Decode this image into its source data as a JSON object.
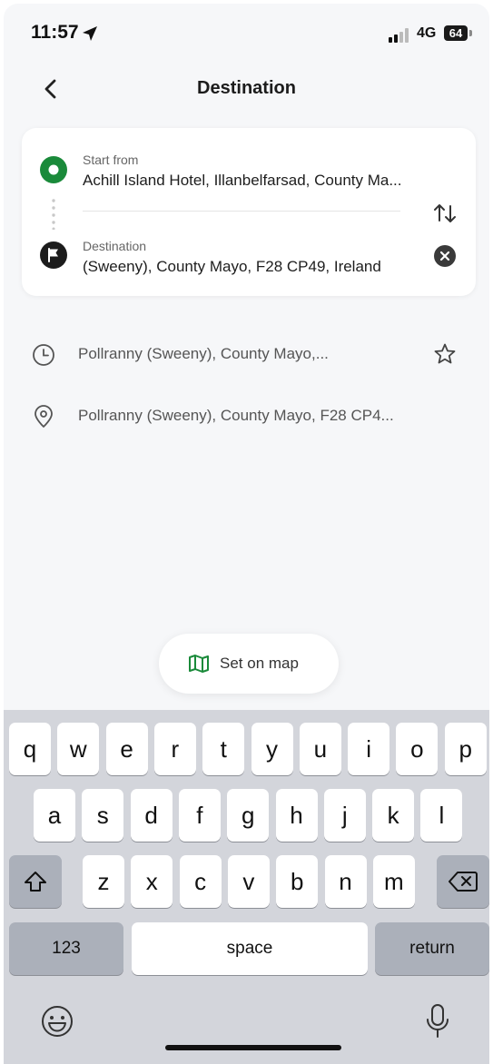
{
  "status_bar": {
    "time": "11:57",
    "network": "4G",
    "battery": "64"
  },
  "header": {
    "title": "Destination"
  },
  "route": {
    "start_label": "Start from",
    "start_value": "Achill Island Hotel, Illanbelfarsad, County Ma...",
    "destination_label": "Destination",
    "destination_value": "(Sweeny), County Mayo, F28 CP49, Ireland"
  },
  "suggestions": [
    {
      "icon": "clock-icon",
      "text": "Pollranny (Sweeny), County Mayo,..."
    },
    {
      "icon": "map-pin-icon",
      "text": "Pollranny (Sweeny), County Mayo, F28 CP4..."
    }
  ],
  "set_on_map": {
    "label": "Set on map"
  },
  "keyboard": {
    "row1": [
      "q",
      "w",
      "e",
      "r",
      "t",
      "y",
      "u",
      "i",
      "o",
      "p"
    ],
    "row2": [
      "a",
      "s",
      "d",
      "f",
      "g",
      "h",
      "j",
      "k",
      "l"
    ],
    "row3": [
      "z",
      "x",
      "c",
      "v",
      "b",
      "n",
      "m"
    ],
    "numbers_label": "123",
    "space_label": "space",
    "return_label": "return"
  },
  "colors": {
    "accent_green": "#1a8a3a",
    "background": "#f6f7f9",
    "keyboard_bg": "#d3d5db",
    "dark_key": "#abb0ba"
  }
}
